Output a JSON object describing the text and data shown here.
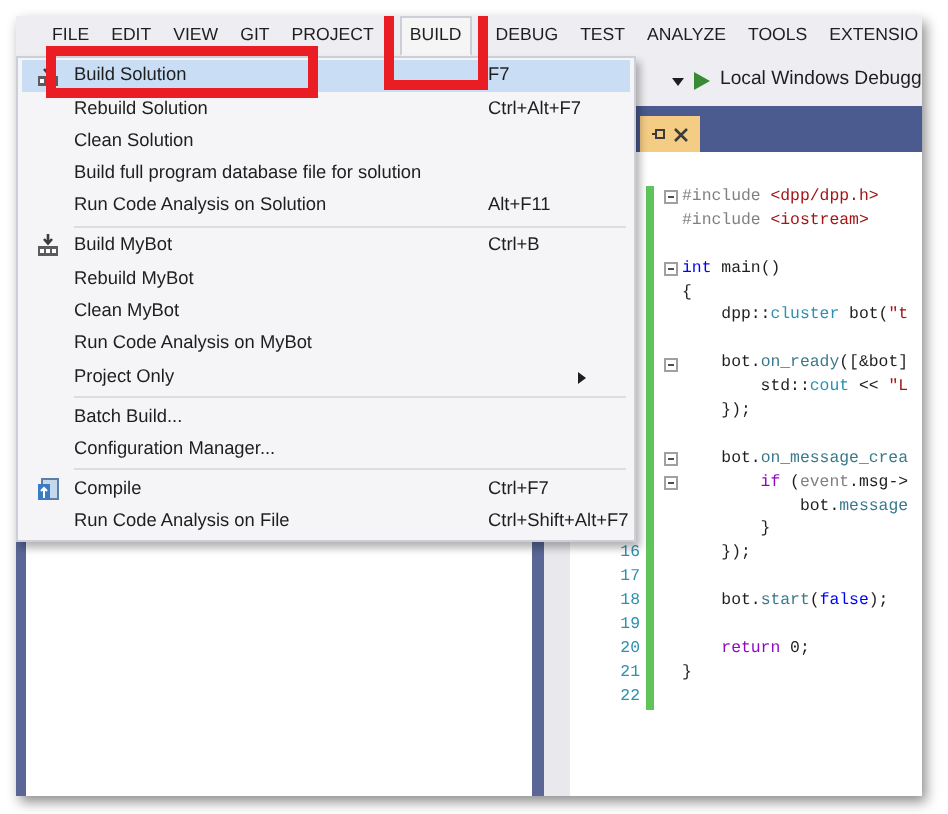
{
  "menu_bar": {
    "items": [
      {
        "label": "FILE",
        "selected": false,
        "callout": false
      },
      {
        "label": "EDIT",
        "selected": false,
        "callout": false
      },
      {
        "label": "VIEW",
        "selected": false,
        "callout": false
      },
      {
        "label": "GIT",
        "selected": false,
        "callout": false
      },
      {
        "label": "PROJECT",
        "selected": false,
        "callout": false
      },
      {
        "label": "BUILD",
        "selected": true,
        "callout": true
      },
      {
        "label": "DEBUG",
        "selected": false,
        "callout": false
      },
      {
        "label": "TEST",
        "selected": false,
        "callout": false
      },
      {
        "label": "ANALYZE",
        "selected": false,
        "callout": false
      },
      {
        "label": "TOOLS",
        "selected": false,
        "callout": false
      },
      {
        "label": "EXTENSIO",
        "selected": false,
        "callout": false
      }
    ]
  },
  "build_menu": {
    "groups": [
      [
        {
          "label": "Build Solution",
          "shortcut": "F7",
          "kind": "build",
          "selected": true,
          "callout": true,
          "submenu": false
        },
        {
          "label": "Rebuild Solution",
          "shortcut": "Ctrl+Alt+F7",
          "selected": false,
          "callout": false,
          "submenu": false
        },
        {
          "label": "Clean Solution",
          "selected": false,
          "callout": false,
          "submenu": false
        },
        {
          "label": "Build full program database file for solution",
          "selected": false,
          "callout": false,
          "submenu": false
        },
        {
          "label": "Run Code Analysis on Solution",
          "shortcut": "Alt+F11",
          "selected": false,
          "callout": false,
          "submenu": false
        }
      ],
      [
        {
          "label": "Build MyBot",
          "shortcut": "Ctrl+B",
          "kind": "build",
          "selected": false,
          "callout": false,
          "submenu": false
        },
        {
          "label": "Rebuild MyBot",
          "selected": false,
          "callout": false,
          "submenu": false
        },
        {
          "label": "Clean MyBot",
          "selected": false,
          "callout": false,
          "submenu": false
        },
        {
          "label": "Run Code Analysis on MyBot",
          "selected": false,
          "callout": false,
          "submenu": false
        },
        {
          "label": "Project Only",
          "selected": false,
          "callout": false,
          "submenu": true
        }
      ],
      [
        {
          "label": "Batch Build...",
          "selected": false,
          "callout": false,
          "submenu": false
        },
        {
          "label": "Configuration Manager...",
          "selected": false,
          "callout": false,
          "submenu": false
        }
      ],
      [
        {
          "label": "Compile",
          "shortcut": "Ctrl+F7",
          "kind": "compile",
          "selected": false,
          "callout": false,
          "submenu": false
        },
        {
          "label": "Run Code Analysis on File",
          "shortcut": "Ctrl+Shift+Alt+F7",
          "selected": false,
          "callout": false,
          "submenu": false
        }
      ]
    ]
  },
  "toolbar": {
    "debugger": "Local Windows Debugg"
  },
  "editor": {
    "lines": [
      {
        "kind": "code",
        "changed": true,
        "foldable": true,
        "tokens": [
          {
            "text": "#include ",
            "kind": "preproc"
          },
          {
            "text": "<dpp/dpp.h>",
            "kind": "string"
          }
        ]
      },
      {
        "kind": "code",
        "changed": true,
        "foldable": false,
        "tokens": [
          {
            "text": "#include ",
            "kind": "preproc"
          },
          {
            "text": "<iostream>",
            "kind": "string"
          }
        ]
      },
      {
        "kind": "blank",
        "changed": true,
        "foldable": false
      },
      {
        "kind": "code",
        "changed": true,
        "foldable": true,
        "tokens": [
          {
            "text": "int",
            "kind": "keyword"
          },
          {
            "text": " main()",
            "kind": "plain"
          }
        ]
      },
      {
        "kind": "code",
        "changed": true,
        "foldable": false,
        "tokens": [
          {
            "text": "{",
            "kind": "plain"
          }
        ]
      },
      {
        "kind": "code",
        "changed": true,
        "foldable": false,
        "tokens": [
          {
            "text": "    dpp::",
            "kind": "plain"
          },
          {
            "text": "cluster",
            "kind": "type"
          },
          {
            "text": " bot(",
            "kind": "plain"
          },
          {
            "text": "\"t",
            "kind": "string"
          }
        ]
      },
      {
        "kind": "blank",
        "changed": true,
        "foldable": false
      },
      {
        "kind": "code",
        "changed": true,
        "foldable": true,
        "tokens": [
          {
            "text": "    bot.",
            "kind": "plain"
          },
          {
            "text": "on_ready",
            "kind": "member"
          },
          {
            "text": "([&bot]",
            "kind": "plain"
          }
        ]
      },
      {
        "kind": "code",
        "changed": true,
        "foldable": false,
        "tokens": [
          {
            "text": "        std::",
            "kind": "plain"
          },
          {
            "text": "cout",
            "kind": "type"
          },
          {
            "text": " << ",
            "kind": "plain"
          },
          {
            "text": "\"L",
            "kind": "string"
          }
        ]
      },
      {
        "kind": "code",
        "changed": true,
        "foldable": false,
        "tokens": [
          {
            "text": "    });",
            "kind": "plain"
          }
        ]
      },
      {
        "kind": "blank",
        "changed": true,
        "foldable": false
      },
      {
        "kind": "code",
        "changed": true,
        "foldable": true,
        "tokens": [
          {
            "text": "    bot.",
            "kind": "plain"
          },
          {
            "text": "on_message_crea",
            "kind": "member"
          }
        ]
      },
      {
        "kind": "code",
        "changed": true,
        "foldable": true,
        "tokens": [
          {
            "text": "        if",
            "kind": "control"
          },
          {
            "text": " (",
            "kind": "plain"
          },
          {
            "text": "event",
            "kind": "param"
          },
          {
            "text": ".msg->",
            "kind": "plain"
          }
        ]
      },
      {
        "kind": "code",
        "changed": true,
        "foldable": false,
        "tokens": [
          {
            "text": "            bot.",
            "kind": "plain"
          },
          {
            "text": "message",
            "kind": "member"
          }
        ]
      },
      {
        "kind": "code",
        "changed": true,
        "foldable": false,
        "tokens": [
          {
            "text": "        }",
            "kind": "plain"
          }
        ]
      },
      {
        "kind": "code",
        "number": "16",
        "changed": true,
        "foldable": false,
        "tokens": [
          {
            "text": "    });",
            "kind": "plain"
          }
        ]
      },
      {
        "kind": "blank",
        "number": "17",
        "changed": true,
        "foldable": false
      },
      {
        "kind": "code",
        "number": "18",
        "changed": true,
        "foldable": false,
        "tokens": [
          {
            "text": "    bot.",
            "kind": "plain"
          },
          {
            "text": "start",
            "kind": "member"
          },
          {
            "text": "(",
            "kind": "plain"
          },
          {
            "text": "false",
            "kind": "keyword"
          },
          {
            "text": ");",
            "kind": "plain"
          }
        ]
      },
      {
        "kind": "blank",
        "number": "19",
        "changed": true,
        "foldable": false
      },
      {
        "kind": "code",
        "number": "20",
        "changed": true,
        "foldable": false,
        "tokens": [
          {
            "text": "    return",
            "kind": "control"
          },
          {
            "text": " 0;",
            "kind": "plain"
          }
        ]
      },
      {
        "kind": "code",
        "number": "21",
        "changed": true,
        "foldable": false,
        "tokens": [
          {
            "text": "}",
            "kind": "plain"
          }
        ]
      },
      {
        "kind": "blank",
        "number": "22",
        "changed": true,
        "foldable": false
      }
    ]
  }
}
